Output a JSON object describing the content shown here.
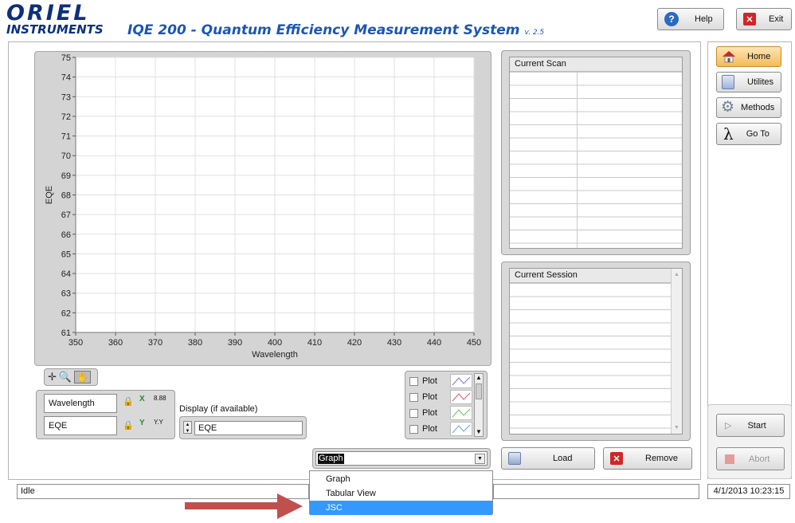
{
  "header": {
    "logo_top": "ORIEL",
    "logo_bottom": "INSTRUMENTS",
    "title": "IQE 200 - Quantum Efficiency Measurement System",
    "version": "v. 2.5",
    "help_label": "Help",
    "exit_label": "Exit"
  },
  "nav": {
    "home_label": "Home",
    "utilities_label": "Utilites",
    "methods_label": "Methods",
    "goto_label": "Go To",
    "lambda_symbol": "λ"
  },
  "chart_data": {
    "type": "line",
    "xlabel": "Wavelength",
    "ylabel": "EQE",
    "xlim": [
      350,
      450
    ],
    "ylim": [
      61,
      75
    ],
    "x_ticks": [
      "350",
      "360",
      "370",
      "380",
      "390",
      "400",
      "410",
      "420",
      "430",
      "440",
      "450"
    ],
    "y_ticks": [
      "75",
      "74",
      "73",
      "72",
      "71",
      "70",
      "69",
      "68",
      "67",
      "66",
      "65",
      "64",
      "63",
      "62",
      "61"
    ],
    "series": [],
    "grid": true
  },
  "axis_controls": {
    "x_name": "Wavelength",
    "y_name": "EQE",
    "x_scale_label": "X",
    "y_scale_label": "Y",
    "x_format": "8.88",
    "y_format": "Y.Y"
  },
  "display": {
    "label": "Display (if available)",
    "value": "EQE"
  },
  "plot_legend": [
    "Plot",
    "Plot",
    "Plot",
    "Plot"
  ],
  "view_select": {
    "value": "Graph",
    "options": [
      "Graph",
      "Tabular View",
      "JSC"
    ],
    "highlighted": "JSC"
  },
  "current_scan": {
    "title": "Current Scan"
  },
  "current_session": {
    "title": "Current Session"
  },
  "actions": {
    "load_label": "Load",
    "remove_label": "Remove",
    "start_label": "Start",
    "abort_label": "Abort"
  },
  "status": {
    "text": "Idle",
    "datetime": "4/1/2013 10:23:15"
  },
  "colors": {
    "brand_blue": "#0d2f7e",
    "title_blue": "#1b56b5",
    "selection_blue": "#3399ff",
    "arrow_red": "#c0504d"
  }
}
